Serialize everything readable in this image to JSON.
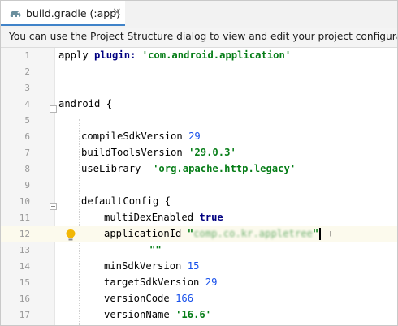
{
  "tab": {
    "title": "build.gradle (:app)",
    "close_glyph": "×",
    "icon": "gradle-elephant-icon"
  },
  "banner": {
    "text": "You can use the Project Structure dialog to view and edit your project configuration"
  },
  "editor": {
    "current_line": 12,
    "lines": [
      {
        "n": "1",
        "text": "apply plugin: 'com.android.application'"
      },
      {
        "n": "2",
        "text": ""
      },
      {
        "n": "3",
        "text": ""
      },
      {
        "n": "4",
        "text": "android {"
      },
      {
        "n": "5",
        "text": ""
      },
      {
        "n": "6",
        "text": "compileSdkVersion 29"
      },
      {
        "n": "7",
        "text": "buildToolsVersion '29.0.3'"
      },
      {
        "n": "8",
        "text": "useLibrary  'org.apache.http.legacy'"
      },
      {
        "n": "9",
        "text": ""
      },
      {
        "n": "10",
        "text": "defaultConfig {"
      },
      {
        "n": "11",
        "text": "multiDexEnabled true"
      },
      {
        "n": "12",
        "text": "applicationId \"com.co.kr.appletree\" +"
      },
      {
        "n": "13",
        "text": "\"\""
      },
      {
        "n": "14",
        "text": "minSdkVersion 15"
      },
      {
        "n": "15",
        "text": "targetSdkVersion 29"
      },
      {
        "n": "16",
        "text": "versionCode 166"
      },
      {
        "n": "17",
        "text": "versionName '16.6'"
      }
    ],
    "tokens": {
      "l1_a": "apply ",
      "l1_kw": "plugin:",
      "l1_str": " 'com.android.application'",
      "l4": "android {",
      "l6_a": "compileSdkVersion ",
      "l6_n": "29",
      "l7_a": "buildToolsVersion ",
      "l7_s": "'29.0.3'",
      "l8_a": "useLibrary  ",
      "l8_s": "'org.apache.http.legacy'",
      "l10": "defaultConfig {",
      "l11_a": "multiDexEnabled ",
      "l11_kw": "true",
      "l12_a": "applicationId ",
      "l12_q1": "\"",
      "l12_blur": "comp.co.kr.appletree",
      "l12_q2": "\"",
      "l12_plus": " +",
      "l13": "\"\"",
      "l14_a": "minSdkVersion ",
      "l14_n": "15",
      "l15_a": "targetSdkVersion ",
      "l15_n": "29",
      "l16_a": "versionCode ",
      "l16_n": "166",
      "l17_a": "versionName ",
      "l17_s": "'16.6'"
    }
  },
  "colors": {
    "string": "#067d17",
    "number": "#1750eb",
    "keyword": "#000080",
    "tab_underline": "#4083c9",
    "current_line_bg": "#fcfaed"
  }
}
